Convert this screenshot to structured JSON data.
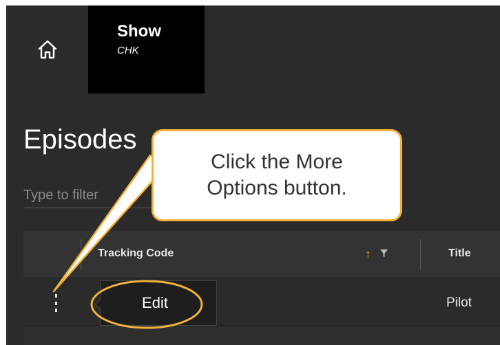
{
  "header": {
    "home_icon": "home-icon",
    "show_title": "Show",
    "show_subtitle": "CHK"
  },
  "page": {
    "title": "Episodes",
    "filter_placeholder": "Type to filter"
  },
  "table": {
    "columns": [
      {
        "label": "Tracking Code",
        "sort": "ascending",
        "filterable": true
      },
      {
        "label": "Title"
      }
    ],
    "rows": [
      {
        "title": "Pilot"
      }
    ],
    "row_menu": {
      "more_icon": "more-options-icon",
      "items": [
        "Edit"
      ]
    }
  },
  "annotation": {
    "callout_line1": "Click the More",
    "callout_line2": "Options button.",
    "accent": "#f3b23a"
  },
  "colors": {
    "background": "#2b2b2b",
    "header_tab": "#000000",
    "sort_accent": "#f2a71b"
  }
}
